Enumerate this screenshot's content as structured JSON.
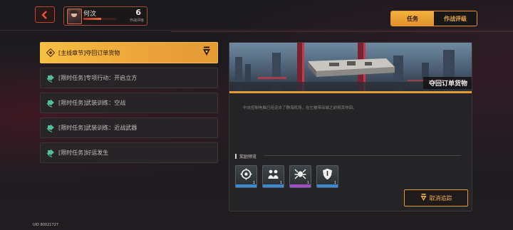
{
  "player": {
    "name": "何汶",
    "level": "6",
    "level_label": "作战评级",
    "xp_fraction": 0.55
  },
  "tabs": [
    {
      "label": "任务",
      "active": true
    },
    {
      "label": "作战评级",
      "active": false
    }
  ],
  "quests": [
    {
      "label": "[主线章节]夺回订单货物",
      "active": true
    },
    {
      "label": "[限时任务]专项行动：开启立方",
      "active": false
    },
    {
      "label": "[限时任务]武装训练：空战",
      "active": false
    },
    {
      "label": "[限时任务]武装训练：近战武器",
      "active": false
    },
    {
      "label": "[限时任务]好运发生",
      "active": false
    }
  ],
  "detail": {
    "banner_title": "夺回订单货物",
    "description": "中央控制电脑已经运去了静海机场，在它被带出城之前将其夺回。",
    "rewards_header": "奖励预览",
    "rewards": [
      {
        "icon": "gear-chip-icon",
        "count": "1",
        "rarity_color": "#3c8ad6"
      },
      {
        "icon": "twin-figures-icon",
        "count": "1",
        "rarity_color": "#3c8ad6"
      },
      {
        "icon": "spider-mech-icon",
        "count": "1",
        "rarity_color": "#a04cc8"
      },
      {
        "icon": "shield-icon",
        "count": "1",
        "rarity_color": "#3c8ad6"
      }
    ],
    "untrack_label": "取消追踪"
  },
  "uid": "UID 80021727",
  "colors": {
    "accent": "#e39a32",
    "accent_light": "#f7bf42",
    "back": "#c0442f"
  }
}
